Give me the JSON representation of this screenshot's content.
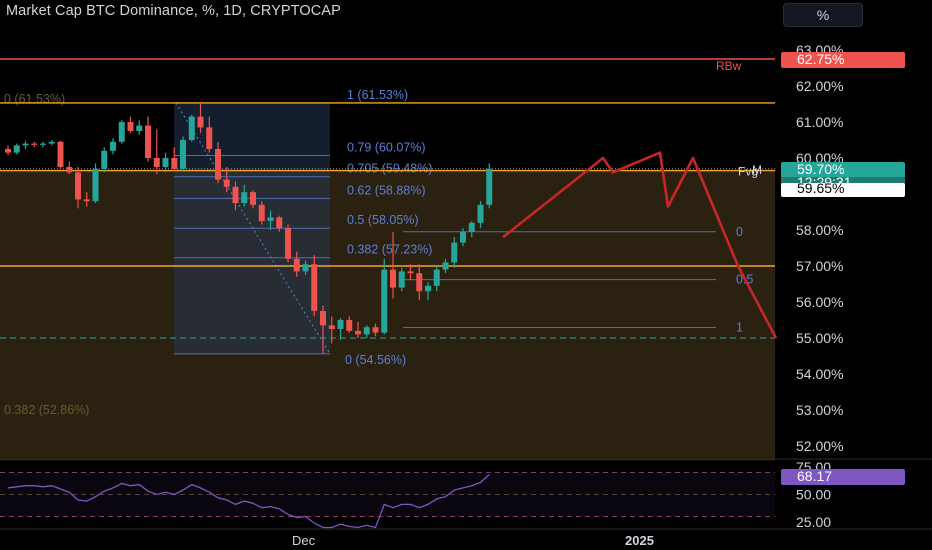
{
  "header": {
    "title": "Market Cap BTC Dominance, %, 1D, CRYPTOCAP",
    "scale_button": "%"
  },
  "colors": {
    "background": "#000000",
    "up": "#26a69a",
    "down": "#ef5350",
    "fib_line": "#5b7fd6",
    "orange_level": "#f5a623",
    "red_level": "#ef5350",
    "projection": "#c62828",
    "rsi": "#7e57c2"
  },
  "chart_data": [
    {
      "type": "candlestick",
      "title": "Market Cap BTC Dominance, %, 1D, CRYPTOCAP",
      "ylim": [
        51.6,
        63.3
      ],
      "y_ticks": [
        "63.00%",
        "62.00%",
        "61.00%",
        "60.00%",
        "58.00%",
        "57.00%",
        "56.00%",
        "55.00%",
        "54.00%",
        "53.00%",
        "52.00%"
      ],
      "x_ticks": [
        "Dec",
        "2025"
      ],
      "candles": [
        {
          "o": 60.25,
          "h": 60.35,
          "l": 60.08,
          "c": 60.15
        },
        {
          "o": 60.15,
          "h": 60.4,
          "l": 60.1,
          "c": 60.35
        },
        {
          "o": 60.35,
          "h": 60.48,
          "l": 60.25,
          "c": 60.4
        },
        {
          "o": 60.4,
          "h": 60.45,
          "l": 60.3,
          "c": 60.38
        },
        {
          "o": 60.38,
          "h": 60.45,
          "l": 60.3,
          "c": 60.4
        },
        {
          "o": 60.4,
          "h": 60.5,
          "l": 60.35,
          "c": 60.45
        },
        {
          "o": 60.45,
          "h": 60.48,
          "l": 59.7,
          "c": 59.75
        },
        {
          "o": 59.75,
          "h": 59.9,
          "l": 59.55,
          "c": 59.6
        },
        {
          "o": 59.6,
          "h": 59.75,
          "l": 58.6,
          "c": 58.85
        },
        {
          "o": 58.85,
          "h": 59.05,
          "l": 58.65,
          "c": 58.8
        },
        {
          "o": 58.8,
          "h": 59.85,
          "l": 58.75,
          "c": 59.7
        },
        {
          "o": 59.7,
          "h": 60.3,
          "l": 59.6,
          "c": 60.2
        },
        {
          "o": 60.2,
          "h": 60.55,
          "l": 60.1,
          "c": 60.45
        },
        {
          "o": 60.45,
          "h": 61.05,
          "l": 60.4,
          "c": 61.0
        },
        {
          "o": 61.0,
          "h": 61.15,
          "l": 60.7,
          "c": 60.75
        },
        {
          "o": 60.75,
          "h": 61.05,
          "l": 60.65,
          "c": 60.9
        },
        {
          "o": 60.9,
          "h": 61.15,
          "l": 59.9,
          "c": 60.0
        },
        {
          "o": 60.0,
          "h": 60.8,
          "l": 59.55,
          "c": 59.75
        },
        {
          "o": 59.75,
          "h": 60.15,
          "l": 59.6,
          "c": 60.0
        },
        {
          "o": 60.0,
          "h": 60.3,
          "l": 59.65,
          "c": 59.7
        },
        {
          "o": 59.7,
          "h": 60.6,
          "l": 59.62,
          "c": 60.5
        },
        {
          "o": 60.5,
          "h": 61.2,
          "l": 60.45,
          "c": 61.15
        },
        {
          "o": 61.15,
          "h": 61.55,
          "l": 60.7,
          "c": 60.85
        },
        {
          "o": 60.85,
          "h": 61.15,
          "l": 60.15,
          "c": 60.25
        },
        {
          "o": 60.25,
          "h": 60.45,
          "l": 59.3,
          "c": 59.4
        },
        {
          "o": 59.4,
          "h": 59.75,
          "l": 59.05,
          "c": 59.2
        },
        {
          "o": 59.2,
          "h": 59.35,
          "l": 58.55,
          "c": 58.75
        },
        {
          "o": 58.75,
          "h": 59.25,
          "l": 58.65,
          "c": 59.05
        },
        {
          "o": 59.05,
          "h": 59.1,
          "l": 58.6,
          "c": 58.7
        },
        {
          "o": 58.7,
          "h": 58.8,
          "l": 58.15,
          "c": 58.25
        },
        {
          "o": 58.25,
          "h": 58.55,
          "l": 58.0,
          "c": 58.35
        },
        {
          "o": 58.35,
          "h": 58.4,
          "l": 57.95,
          "c": 58.05
        },
        {
          "o": 58.05,
          "h": 58.15,
          "l": 57.1,
          "c": 57.2
        },
        {
          "o": 57.2,
          "h": 57.4,
          "l": 56.7,
          "c": 56.85
        },
        {
          "o": 56.85,
          "h": 57.15,
          "l": 56.75,
          "c": 57.05
        },
        {
          "o": 57.05,
          "h": 57.3,
          "l": 55.6,
          "c": 55.75
        },
        {
          "o": 55.75,
          "h": 55.9,
          "l": 54.56,
          "c": 55.35
        },
        {
          "o": 55.35,
          "h": 55.6,
          "l": 54.85,
          "c": 55.25
        },
        {
          "o": 55.25,
          "h": 55.55,
          "l": 54.95,
          "c": 55.5
        },
        {
          "o": 55.5,
          "h": 55.6,
          "l": 55.15,
          "c": 55.2
        },
        {
          "o": 55.2,
          "h": 55.45,
          "l": 55.0,
          "c": 55.1
        },
        {
          "o": 55.1,
          "h": 55.35,
          "l": 55.0,
          "c": 55.3
        },
        {
          "o": 55.3,
          "h": 55.4,
          "l": 55.05,
          "c": 55.15
        },
        {
          "o": 55.15,
          "h": 57.2,
          "l": 55.1,
          "c": 56.9
        },
        {
          "o": 56.9,
          "h": 57.95,
          "l": 56.1,
          "c": 56.4
        },
        {
          "o": 56.4,
          "h": 56.95,
          "l": 56.3,
          "c": 56.85
        },
        {
          "o": 56.85,
          "h": 57.05,
          "l": 56.6,
          "c": 56.8
        },
        {
          "o": 56.8,
          "h": 57.05,
          "l": 56.05,
          "c": 56.3
        },
        {
          "o": 56.3,
          "h": 56.55,
          "l": 56.05,
          "c": 56.45
        },
        {
          "o": 56.45,
          "h": 57.0,
          "l": 56.3,
          "c": 56.9
        },
        {
          "o": 56.9,
          "h": 57.2,
          "l": 56.8,
          "c": 57.1
        },
        {
          "o": 57.1,
          "h": 57.8,
          "l": 56.95,
          "c": 57.65
        },
        {
          "o": 57.65,
          "h": 58.05,
          "l": 57.55,
          "c": 57.95
        },
        {
          "o": 57.95,
          "h": 58.25,
          "l": 57.8,
          "c": 58.2
        },
        {
          "o": 58.2,
          "h": 58.8,
          "l": 58.05,
          "c": 58.7
        },
        {
          "o": 58.7,
          "h": 59.85,
          "l": 58.6,
          "c": 59.7
        }
      ],
      "fib_retracement": {
        "labels": [
          "1 (61.53%)",
          "0.79 (60.07%)",
          "0.705 (59.48%)",
          "0.62 (58.88%)",
          "0.5 (58.05%)",
          "0.382 (57.23%)",
          "0 (54.56%)"
        ],
        "values": [
          61.53,
          60.07,
          59.48,
          58.88,
          58.05,
          57.23,
          54.56
        ]
      },
      "fib_small": {
        "labels": [
          "0",
          "0.5",
          "1"
        ],
        "values": [
          57.95,
          56.62,
          55.29
        ]
      },
      "horizontal_levels": [
        {
          "label": "RBw",
          "value": 62.75,
          "color": "#ef5350"
        },
        {
          "label": "",
          "value": 61.53,
          "color": "#f5a623"
        },
        {
          "label": "Fvg",
          "value": 59.65,
          "color": "#f5a623"
        },
        {
          "label": "",
          "value": 57.0,
          "color": "#f5a623"
        },
        {
          "label": "",
          "value": 55.0,
          "color": "#26a69a"
        }
      ],
      "left_faded_labels": [
        "0 (61.53%)",
        "0.382 (52.86%)"
      ],
      "fvg_zone": [
        51.6,
        59.65
      ],
      "projection_path": [
        57.8,
        60.0,
        59.6,
        60.15,
        58.65,
        60.0,
        57.0,
        55.0
      ],
      "price_tags": {
        "current": "59.70%",
        "countdown": "12:29:31",
        "fvg": "59.65%",
        "rbw": "62.75%"
      },
      "marker_label": "M"
    },
    {
      "type": "line",
      "title": "",
      "ylim": [
        15,
        80
      ],
      "y_ticks": [
        "75.00",
        "50.00",
        "25.00"
      ],
      "bands": [
        70,
        50,
        30
      ],
      "series": [
        {
          "values": [
            56,
            57,
            58,
            58,
            57,
            58,
            55,
            52,
            45,
            44,
            48,
            53,
            56,
            60,
            58,
            59,
            53,
            50,
            52,
            50,
            54,
            59,
            56,
            52,
            47,
            45,
            41,
            44,
            42,
            38,
            39,
            37,
            32,
            29,
            30,
            24,
            20,
            20,
            23,
            21,
            20,
            22,
            20,
            41,
            38,
            41,
            41,
            38,
            41,
            46,
            48,
            54,
            56,
            58,
            61,
            68.17
          ]
        }
      ],
      "last_value": "68.17"
    }
  ]
}
